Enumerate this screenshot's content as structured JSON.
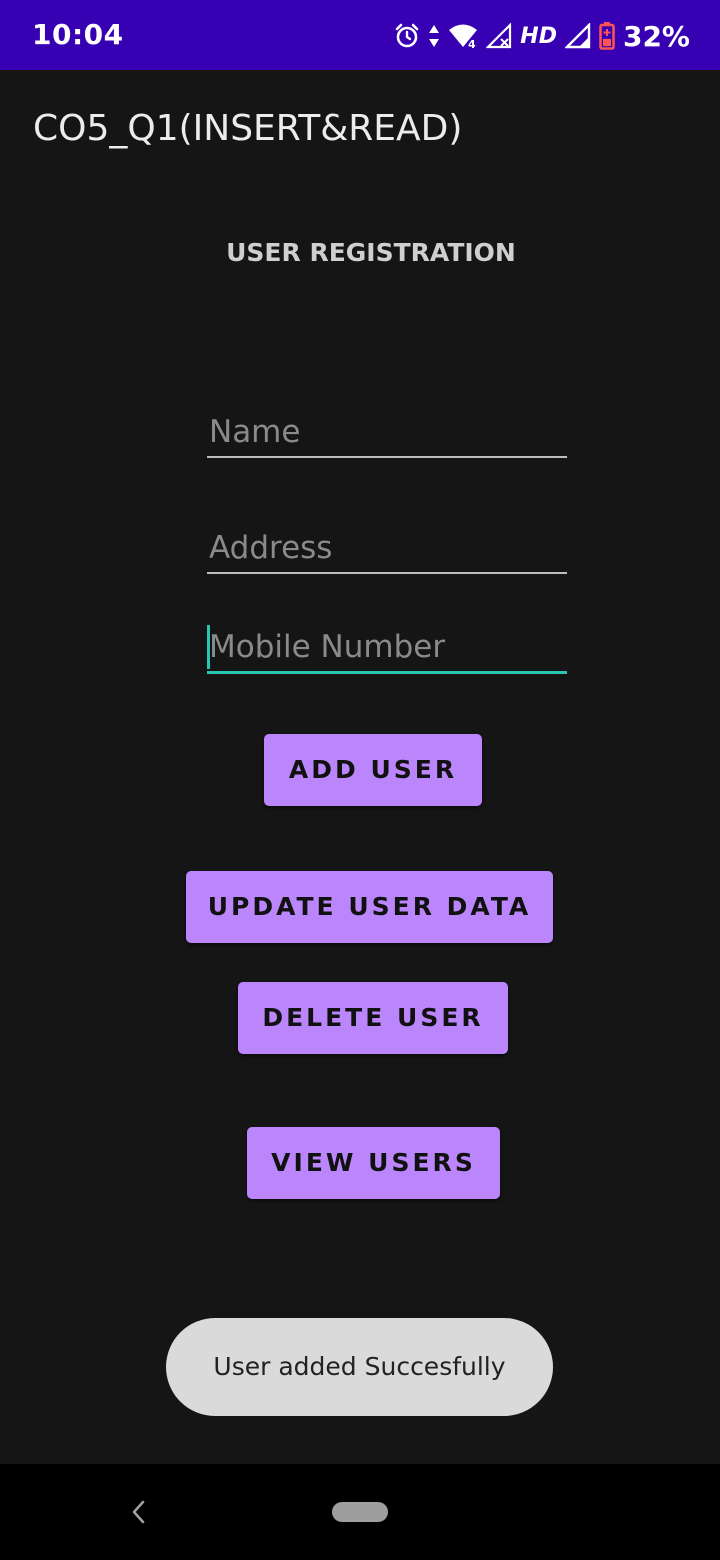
{
  "status_bar": {
    "time": "10:04",
    "icons": [
      "alarm-icon",
      "data-arrows-icon",
      "wifi-4-icon",
      "signal-x-icon",
      "signal-icon",
      "battery-icon"
    ],
    "hd_label": "HD",
    "battery_percent": "32%",
    "background_color": "#3700b3"
  },
  "app_bar": {
    "title": "CO5_Q1(INSERT&READ)"
  },
  "form": {
    "heading": "USER REGISTRATION",
    "name_field": {
      "value": "",
      "placeholder": "Name"
    },
    "address_field": {
      "value": "",
      "placeholder": "Address"
    },
    "mobile_field": {
      "value": "",
      "placeholder": "Mobile Number",
      "focused": true
    }
  },
  "buttons": {
    "add_user": "ADD USER",
    "update_user": "UPDATE USER DATA",
    "delete_user": "DELETE USER",
    "view_users": "VIEW USERS"
  },
  "toast": {
    "message": "User added Succesfully"
  },
  "colors": {
    "background": "#151515",
    "accent": "#bb86fc",
    "focus": "#26c6b0"
  },
  "nav_bar": {
    "icons": [
      "back-icon",
      "home-pill-icon"
    ]
  }
}
